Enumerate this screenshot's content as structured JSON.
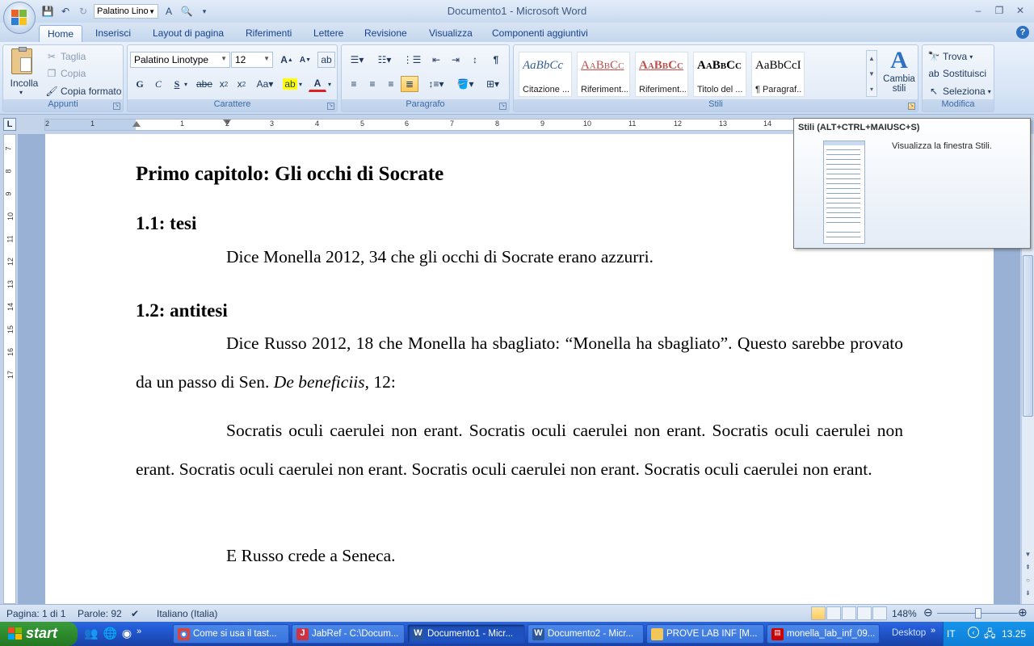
{
  "window": {
    "title": "Documento1 - Microsoft Word",
    "qat_font": "Palatino Lino"
  },
  "tabs": [
    "Home",
    "Inserisci",
    "Layout di pagina",
    "Riferimenti",
    "Lettere",
    "Revisione",
    "Visualizza",
    "Componenti aggiuntivi"
  ],
  "ribbon": {
    "clipboard": {
      "label": "Appunti",
      "paste": "Incolla",
      "cut": "Taglia",
      "copy": "Copia",
      "format_painter": "Copia formato"
    },
    "font": {
      "label": "Carattere",
      "font_name": "Palatino Linotype",
      "font_size": "12"
    },
    "paragraph": {
      "label": "Paragrafo"
    },
    "styles": {
      "label": "Stili",
      "items": [
        {
          "sample": "AaBbCc",
          "name": "Citazione ..."
        },
        {
          "sample": "AaBbCc",
          "name": "Riferiment..."
        },
        {
          "sample": "AaBbCc",
          "name": "Riferiment..."
        },
        {
          "sample": "AaBbCc",
          "name": "Titolo del ..."
        },
        {
          "sample": "AaBbCcI",
          "name": "¶ Paragraf..."
        }
      ],
      "change": "Cambia stili"
    },
    "editing": {
      "label": "Modifica",
      "find": "Trova",
      "replace": "Sostituisci",
      "select": "Seleziona"
    }
  },
  "tooltip": {
    "title": "Stili (ALT+CTRL+MAIUSC+S)",
    "description": "Visualizza la finestra Stili."
  },
  "document": {
    "heading1": "Primo capitolo: Gli occhi di Socrate",
    "sec1_title": "1.1: tesi",
    "sec1_text": "Dice Monella 2012, 34 che gli occhi di Socrate erano azzurri.",
    "sec2_title": "1.2: antitesi",
    "sec2_text_a": "Dice Russo 2012, 18 che Monella ha sbagliato: “Monella ha sbagliato”. Questo sarebbe provato da un passo di Sen. ",
    "sec2_text_italic": "De beneficiis",
    "sec2_text_b": ", 12:",
    "quote": "Socratis oculi caerulei non erant. Socratis oculi caerulei non erant. Socratis oculi caerulei non erant. Socratis oculi caerulei non erant. Socratis oculi caerulei non erant. Socratis oculi caerulei non erant.",
    "closing": "E Russo crede a Seneca."
  },
  "statusbar": {
    "page": "Pagina: 1 di 1",
    "words": "Parole: 92",
    "language": "Italiano (Italia)",
    "zoom": "148%"
  },
  "taskbar": {
    "start": "start",
    "tasks": [
      "Come si usa il tast...",
      "JabRef - C:\\Docum...",
      "Documento1 - Micr...",
      "Documento2 - Micr...",
      "PROVE LAB INF [M...",
      "monella_lab_inf_09..."
    ],
    "desktop": "Desktop",
    "lang": "IT",
    "clock": "13.25"
  },
  "colors": {
    "ribbon_bg": "#d6e4f5",
    "accent": "#15428b",
    "taskbar": "#245edb",
    "start": "#2f8f2f"
  }
}
